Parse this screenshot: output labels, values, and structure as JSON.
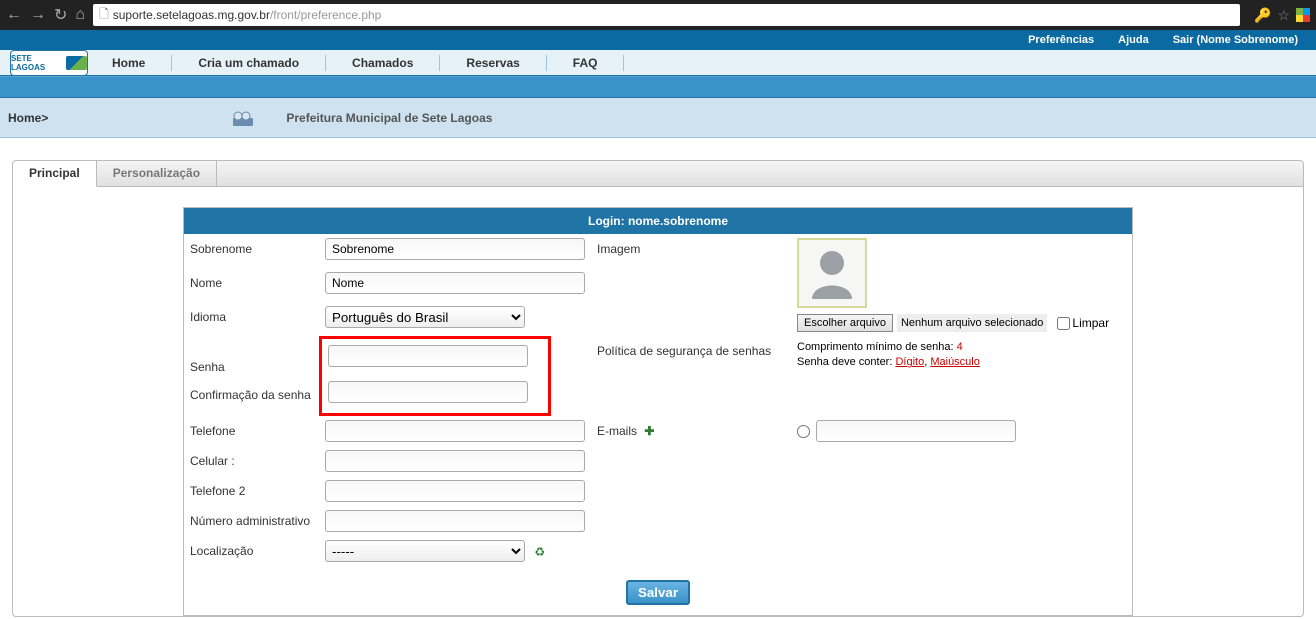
{
  "browser": {
    "url_dark": "suporte.setelagoas.mg.gov.br",
    "url_light": "/front/preference.php"
  },
  "topbar": {
    "preferencias": "Preferências",
    "ajuda": "Ajuda",
    "sair": "Sair (Nome Sobrenome)"
  },
  "logo_text": "SETE LAGOAS",
  "nav": {
    "home": "Home",
    "cria": "Cria um chamado",
    "chamados": "Chamados",
    "reservas": "Reservas",
    "faq": "FAQ"
  },
  "breadcrumb": {
    "home": "Home>",
    "entity": "Prefeitura Municipal de Sete Lagoas"
  },
  "tabs": {
    "principal": "Principal",
    "personalizacao": "Personalização"
  },
  "form": {
    "title": "Login: nome.sobrenome",
    "labels": {
      "sobrenome": "Sobrenome",
      "nome": "Nome",
      "idioma": "Idioma",
      "senha": "Senha",
      "confirmacao": "Confirmação da senha",
      "telefone": "Telefone",
      "celular": "Celular :",
      "telefone2": "Telefone 2",
      "numero_admin": "Número administrativo",
      "localizacao": "Localização",
      "imagem": "Imagem",
      "politica": "Política de segurança de senhas",
      "emails": "E-mails"
    },
    "values": {
      "sobrenome": "Sobrenome",
      "nome": "Nome",
      "idioma": "Português do Brasil",
      "localizacao": "-----"
    },
    "file": {
      "choose": "Escolher arquivo",
      "none": "Nenhum arquivo selecionado",
      "limpar": "Limpar"
    },
    "policy": {
      "line1_pre": "Comprimento mínimo de senha: ",
      "line1_val": "4",
      "line2_pre": "Senha deve conter: ",
      "digito": "Dígito",
      "sep": ", ",
      "maiusculo": "Maiúsculo"
    },
    "save": "Salvar"
  }
}
